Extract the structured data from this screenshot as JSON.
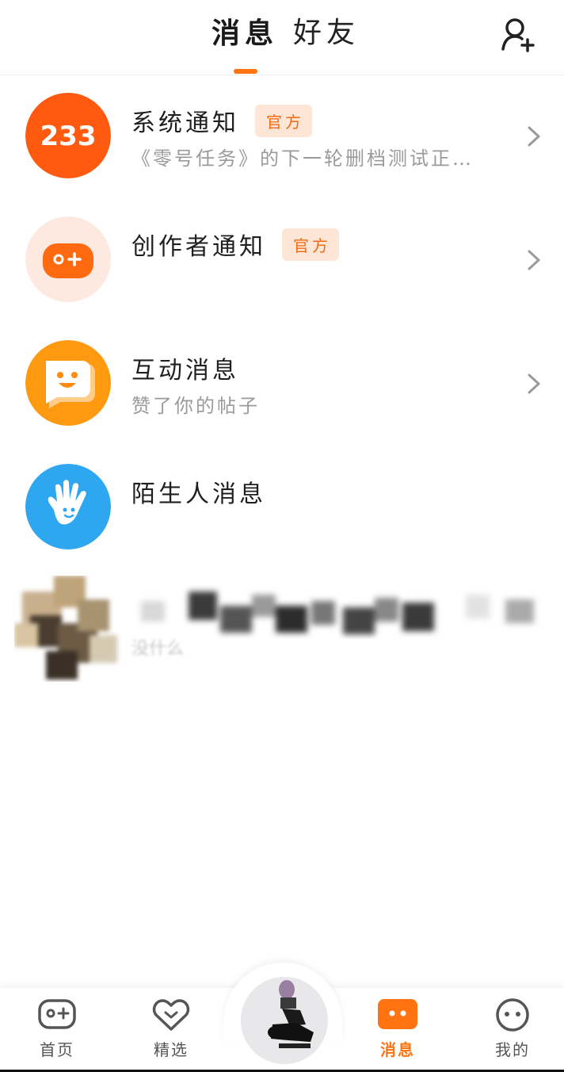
{
  "header": {
    "tabs": [
      {
        "label": "消息",
        "active": true
      },
      {
        "label": "好友",
        "active": false
      }
    ],
    "add_friend_icon": "add-user-icon",
    "accent": "#ff7310"
  },
  "messages": [
    {
      "title": "系统通知",
      "badge": "官方",
      "subtitle": "《零号任务》的下一轮删档测试正…",
      "icon": "233-logo",
      "avatar_text": "233",
      "avatar_color": "#ff5a10"
    },
    {
      "title": "创作者通知",
      "badge": "官方",
      "subtitle": "",
      "icon": "gamepad-plus-icon",
      "avatar_color": "#fde9e0"
    },
    {
      "title": "互动消息",
      "badge": "",
      "subtitle": "赞了你的帖子",
      "icon": "smile-chat-icon",
      "avatar_color": "#ff9a10"
    },
    {
      "title": "陌生人消息",
      "badge": "",
      "subtitle": "",
      "icon": "hand-wave-icon",
      "avatar_color": "#2fa6f0"
    }
  ],
  "blurred_conversation": {
    "subtitle": "没什么"
  },
  "bottom_nav": {
    "items": [
      {
        "label": "首页",
        "icon": "gamepad-home-icon",
        "active": false
      },
      {
        "label": "精选",
        "icon": "heart-chevron-icon",
        "active": false
      },
      {
        "label": "",
        "icon": "user-avatar",
        "active": false
      },
      {
        "label": "消息",
        "icon": "chat-bubble-icon",
        "active": true
      },
      {
        "label": "我的",
        "icon": "face-icon",
        "active": false
      }
    ]
  }
}
